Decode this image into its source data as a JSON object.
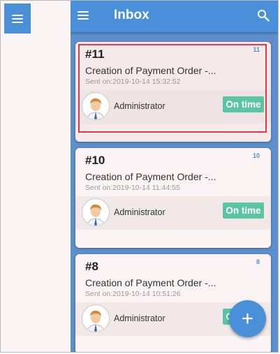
{
  "app": {
    "title": "Inbox"
  },
  "cards": [
    {
      "number": "#11",
      "count": "11",
      "subject": "Creation of Payment Order -...",
      "sent": "Sent on:2019-10-14 15:32:52",
      "user": "Administrator",
      "status": "On time",
      "selected": true
    },
    {
      "number": "#10",
      "count": "10",
      "subject": "Creation of Payment Order -...",
      "sent": "Sent on:2019-10-14 11:44:55",
      "user": "Administrator",
      "status": "On time",
      "selected": false
    },
    {
      "number": "#8",
      "count": "8",
      "subject": "Creation of Payment Order -...",
      "sent": "Sent on:2019-10-14 10:51:26",
      "user": "Administrator",
      "status": "On time",
      "selected": false
    }
  ],
  "fab": {
    "label": "+"
  },
  "colors": {
    "appbar": "#4a8fd9",
    "badge": "#5bc5a3",
    "highlight": "#e0394f"
  }
}
